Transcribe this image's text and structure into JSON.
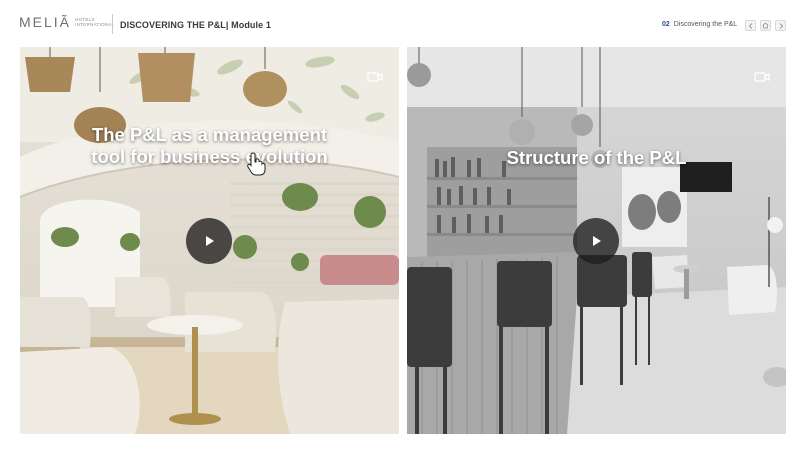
{
  "header": {
    "logo_text": "MELIÃ",
    "logo_sub_line1": "HOTELS",
    "logo_sub_line2": "INTERNATIONAL",
    "course_title": "DISCOVERING THE P&L| Module 1",
    "section_number": "02",
    "section_label": "Discovering the P&L",
    "nav": {
      "prev_icon": "chevron-left-icon",
      "home_icon": "home-icon",
      "next_icon": "chevron-right-icon"
    }
  },
  "cards": [
    {
      "title": "The P&L as a management tool for business evolution",
      "icon": "video-camera-icon",
      "play_icon": "play-icon"
    },
    {
      "title": "Structure of the P&L",
      "icon": "video-camera-icon",
      "play_icon": "play-icon"
    }
  ],
  "colors": {
    "accent": "#2c4b8f",
    "play_button": "#1e1e1e"
  }
}
